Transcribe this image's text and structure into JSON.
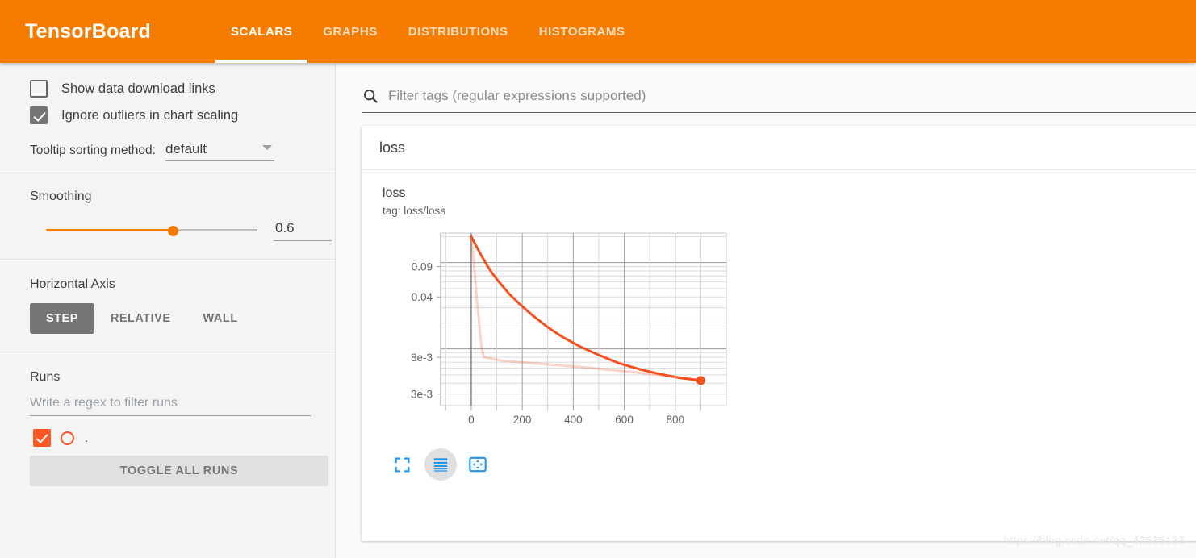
{
  "header": {
    "brand": "TensorBoard",
    "tabs": [
      {
        "label": "SCALARS",
        "active": true
      },
      {
        "label": "GRAPHS",
        "active": false
      },
      {
        "label": "DISTRIBUTIONS",
        "active": false
      },
      {
        "label": "HISTOGRAMS",
        "active": false
      }
    ],
    "bg_color": "#f57c00"
  },
  "sidebar": {
    "show_download_links_label": "Show data download links",
    "show_download_links_checked": false,
    "ignore_outliers_label": "Ignore outliers in chart scaling",
    "ignore_outliers_checked": true,
    "tooltip_sorting_label": "Tooltip sorting method:",
    "tooltip_sorting_value": "default",
    "smoothing_title": "Smoothing",
    "smoothing_value": "0.6",
    "smoothing_percent": 60,
    "horizontal_axis_title": "Horizontal Axis",
    "axis_buttons": [
      {
        "label": "STEP",
        "active": true
      },
      {
        "label": "RELATIVE",
        "active": false
      },
      {
        "label": "WALL",
        "active": false
      }
    ],
    "runs_title": "Runs",
    "runs_filter_placeholder": "Write a regex to filter runs",
    "runs": [
      {
        "name": ".",
        "checked": true,
        "color": "#ff5722"
      }
    ],
    "toggle_all_label": "TOGGLE ALL RUNS"
  },
  "main": {
    "filter_placeholder": "Filter tags (regular expressions supported)",
    "search_icon": "search-icon",
    "card_group_title": "loss",
    "chart_title": "loss",
    "chart_tag": "tag: loss/loss",
    "tools": [
      {
        "name": "expand-chart-icon",
        "label": "Fit / expand chart",
        "active": false
      },
      {
        "name": "toggle-y-axis-log-icon",
        "label": "Toggle y-axis log scale",
        "active": true
      },
      {
        "name": "fit-domain-to-data-icon",
        "label": "Fit domain to data",
        "active": false
      }
    ]
  },
  "chart_data": {
    "type": "line",
    "title": "loss",
    "subtitle": "tag: loss/loss",
    "xlabel": "",
    "ylabel": "",
    "yscale": "log",
    "xlim": [
      -120,
      1000
    ],
    "ylim": [
      0.0022,
      0.22
    ],
    "xticks": [
      0,
      200,
      400,
      600,
      800
    ],
    "xtick_labels": [
      "0",
      "200",
      "400",
      "600",
      "800"
    ],
    "yticks": [
      0.09,
      0.04,
      0.008,
      0.003
    ],
    "ytick_labels": [
      "0.09",
      "0.04",
      "8e-3",
      "3e-3"
    ],
    "grid": true,
    "legend": "none",
    "line_color": "#f4511e",
    "faded_color": "#f4511e",
    "series": [
      {
        "name": "loss/loss (smoothed)",
        "opacity": 1.0,
        "width": 3,
        "x": [
          0,
          20,
          40,
          60,
          80,
          110,
          150,
          190,
          240,
          300,
          360,
          430,
          500,
          580,
          660,
          740,
          820,
          900
        ],
        "y": [
          0.2,
          0.155,
          0.12,
          0.095,
          0.077,
          0.059,
          0.043,
          0.033,
          0.0245,
          0.0178,
          0.0136,
          0.0105,
          0.0085,
          0.0068,
          0.0058,
          0.0051,
          0.0046,
          0.0043
        ]
      },
      {
        "name": "loss/loss (raw)",
        "opacity": 0.25,
        "width": 3,
        "x": [
          0,
          10,
          25,
          40,
          50,
          120,
          250,
          420,
          600,
          760,
          900
        ],
        "y": [
          0.2,
          0.1,
          0.03,
          0.0105,
          0.008,
          0.0073,
          0.0068,
          0.0062,
          0.0055,
          0.0049,
          0.0043
        ]
      }
    ],
    "markers": [
      {
        "x": 900,
        "y": 0.0043,
        "color": "#f4511e",
        "r": 5.5
      }
    ]
  },
  "watermark": "https://blog.csdn.net/qq_42535133"
}
